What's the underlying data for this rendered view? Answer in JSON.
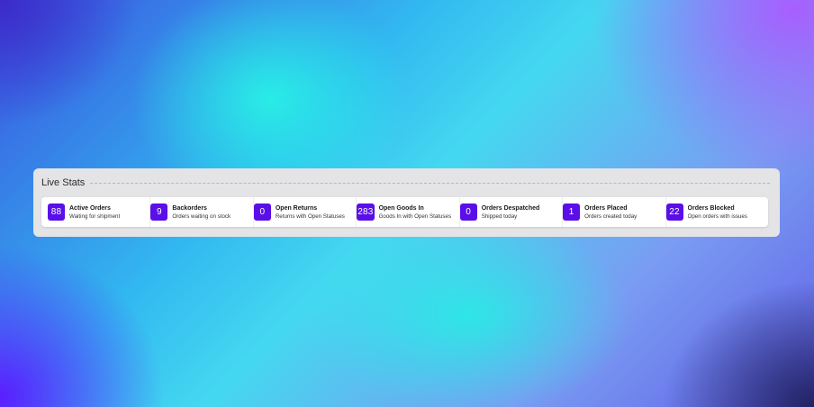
{
  "panel": {
    "title": "Live Stats"
  },
  "stats": [
    {
      "value": "88",
      "title": "Active Orders",
      "subtitle": "Waiting for shipment"
    },
    {
      "value": "9",
      "title": "Backorders",
      "subtitle": "Orders waiting on stock"
    },
    {
      "value": "0",
      "title": "Open Returns",
      "subtitle": "Returns with Open Statuses"
    },
    {
      "value": "283",
      "title": "Open Goods In",
      "subtitle": "Goods In with Open Statuses"
    },
    {
      "value": "0",
      "title": "Orders Despatched",
      "subtitle": "Shipped today"
    },
    {
      "value": "1",
      "title": "Orders Placed",
      "subtitle": "Orders created today"
    },
    {
      "value": "22",
      "title": "Orders Blocked",
      "subtitle": "Open orders with issues"
    }
  ],
  "colors": {
    "badge": "#5a0fe8",
    "panel_background": "#e4e4e6",
    "card_background": "#ffffff"
  }
}
